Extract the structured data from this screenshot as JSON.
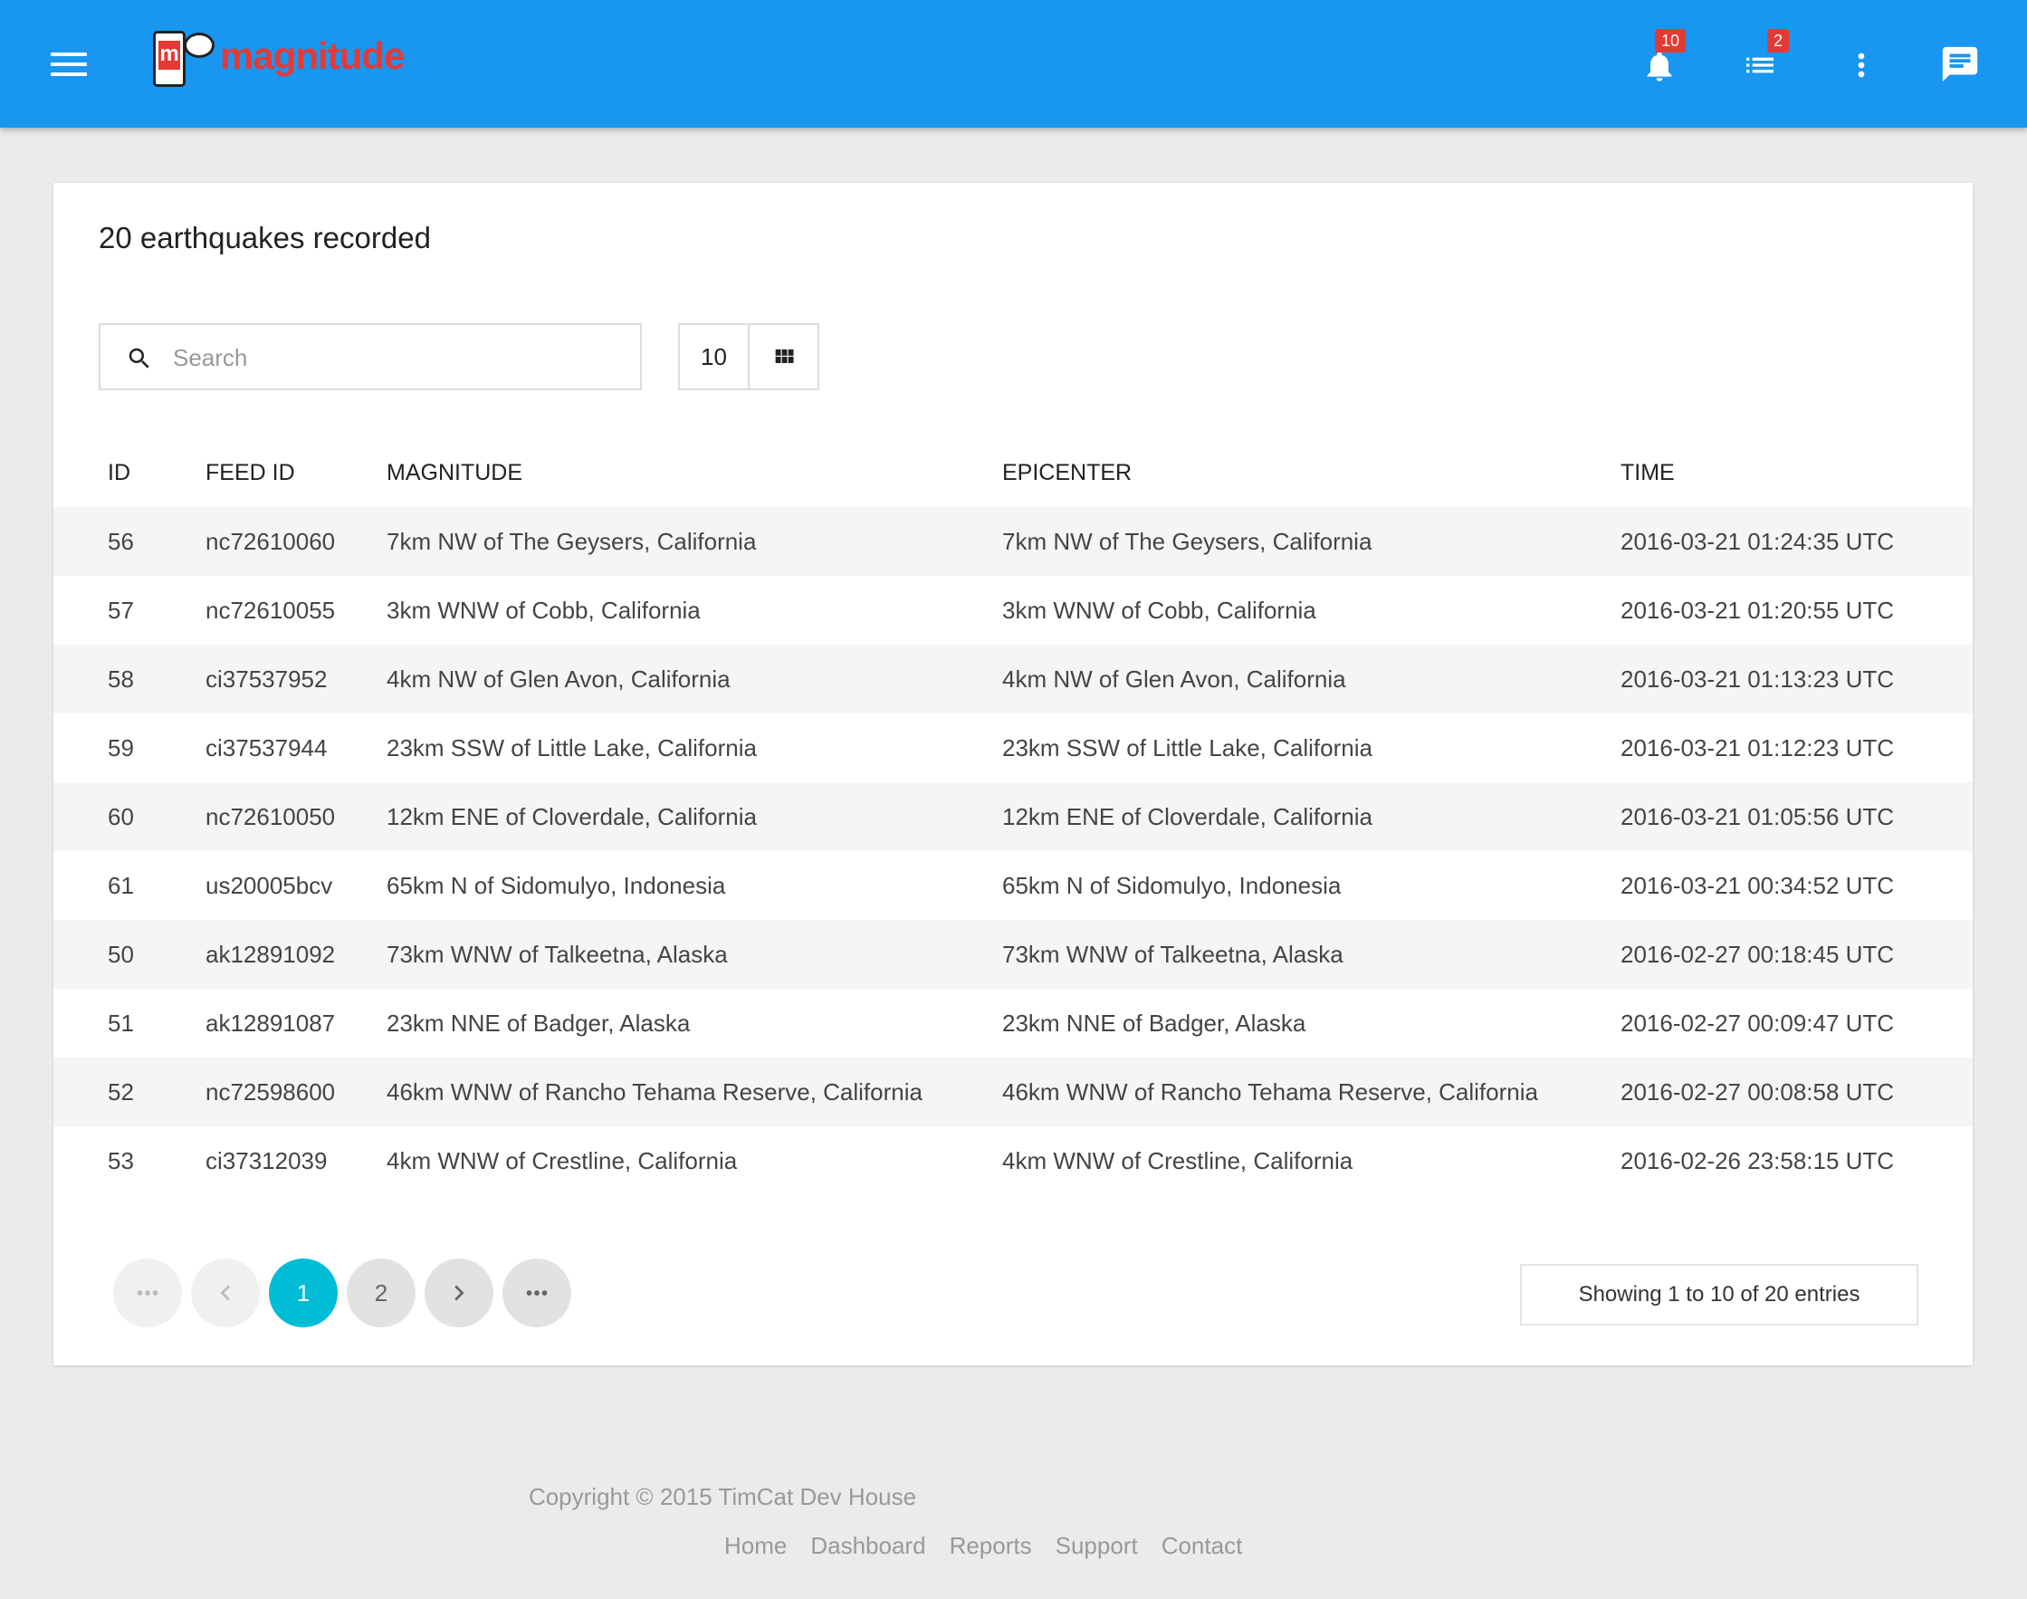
{
  "header": {
    "app_name": "magnitude",
    "logo_letter": "m",
    "notifications_badge": "10",
    "tasks_badge": "2",
    "colors": {
      "bar": "#1896f0",
      "badge": "#e53935",
      "logo": "#e53935"
    }
  },
  "card": {
    "title": "20 earthquakes recorded",
    "search_placeholder": "Search",
    "page_length": "10"
  },
  "table": {
    "columns": [
      "ID",
      "FEED ID",
      "MAGNITUDE",
      "EPICENTER",
      "TIME"
    ],
    "rows": [
      [
        "56",
        "nc72610060",
        "7km NW of The Geysers, California",
        "7km NW of The Geysers, California",
        "2016-03-21 01:24:35 UTC"
      ],
      [
        "57",
        "nc72610055",
        "3km WNW of Cobb, California",
        "3km WNW of Cobb, California",
        "2016-03-21 01:20:55 UTC"
      ],
      [
        "58",
        "ci37537952",
        "4km NW of Glen Avon, California",
        "4km NW of Glen Avon, California",
        "2016-03-21 01:13:23 UTC"
      ],
      [
        "59",
        "ci37537944",
        "23km SSW of Little Lake, California",
        "23km SSW of Little Lake, California",
        "2016-03-21 01:12:23 UTC"
      ],
      [
        "60",
        "nc72610050",
        "12km ENE of Cloverdale, California",
        "12km ENE of Cloverdale, California",
        "2016-03-21 01:05:56 UTC"
      ],
      [
        "61",
        "us20005bcv",
        "65km N of Sidomulyo, Indonesia",
        "65km N of Sidomulyo, Indonesia",
        "2016-03-21 00:34:52 UTC"
      ],
      [
        "50",
        "ak12891092",
        "73km WNW of Talkeetna, Alaska",
        "73km WNW of Talkeetna, Alaska",
        "2016-02-27 00:18:45 UTC"
      ],
      [
        "51",
        "ak12891087",
        "23km NNE of Badger, Alaska",
        "23km NNE of Badger, Alaska",
        "2016-02-27 00:09:47 UTC"
      ],
      [
        "52",
        "nc72598600",
        "46km WNW of Rancho Tehama Reserve, California",
        "46km WNW of Rancho Tehama Reserve, California",
        "2016-02-27 00:08:58 UTC"
      ],
      [
        "53",
        "ci37312039",
        "4km WNW of Crestline, California",
        "4km WNW of Crestline, California",
        "2016-02-26 23:58:15 UTC"
      ]
    ]
  },
  "pagination": {
    "pages": [
      "1",
      "2"
    ],
    "active_page": "1",
    "info": "Showing 1 to 10 of 20 entries",
    "active_color": "#00bcd4"
  },
  "footer": {
    "copyright": "Copyright © 2015 TimCat Dev House",
    "links": [
      "Home",
      "Dashboard",
      "Reports",
      "Support",
      "Contact"
    ]
  }
}
